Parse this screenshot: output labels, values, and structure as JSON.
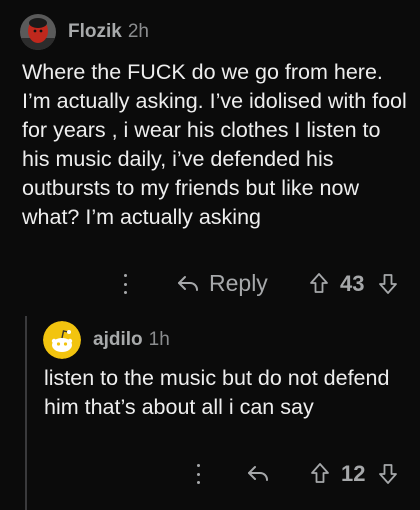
{
  "comments": [
    {
      "username": "Flozik",
      "age": "2h",
      "body": "Where the FUCK do we go from here. I’m actually asking. I’ve idolised with fool for years , i wear his clothes I listen to his music daily, i’ve defended his outbursts to my friends but like now what? I’m actually asking",
      "reply_label": "Reply",
      "score": "43"
    },
    {
      "username": "ajdilo",
      "age": "1h",
      "body": "listen to the music but do not defend him that’s about all i can say",
      "score": "12"
    }
  ],
  "icons": {
    "more": "more-vertical-icon",
    "reply": "reply-arrow-icon",
    "upvote": "upvote-arrow-icon",
    "downvote": "downvote-arrow-icon"
  },
  "colors": {
    "background": "#0b0b0b",
    "text": "#eeeeee",
    "meta": "#a8aaab",
    "thread_line": "#3a3a3c",
    "avatar2_bg": "#f2c40f"
  }
}
